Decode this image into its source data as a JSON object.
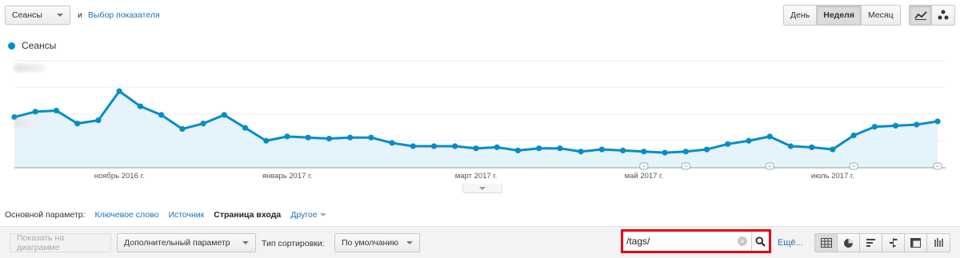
{
  "top": {
    "metric_select": "Сеансы",
    "and_text": "и",
    "choose_metric_link": "Выбор показателя"
  },
  "period_buttons": [
    "День",
    "Неделя",
    "Месяц"
  ],
  "period_active": "Неделя",
  "view_buttons": [
    "line-chart-icon",
    "motion-chart-icon"
  ],
  "legend": {
    "series_name": "Сеансы",
    "color": "#058dc7"
  },
  "chart_data": {
    "type": "area",
    "title": "",
    "xlabel": "",
    "ylabel": "",
    "x_tick_labels": [
      "ноябрь 2016 г.",
      "январь 2017 г.",
      "март 2017 г.",
      "май 2017 г.",
      "июль 2017 г."
    ],
    "series": [
      {
        "name": "Сеансы",
        "color": "#058dc7",
        "values": [
          0.47,
          0.52,
          0.53,
          0.41,
          0.44,
          0.71,
          0.57,
          0.49,
          0.36,
          0.41,
          0.49,
          0.37,
          0.25,
          0.29,
          0.28,
          0.27,
          0.28,
          0.28,
          0.23,
          0.2,
          0.2,
          0.2,
          0.18,
          0.19,
          0.16,
          0.18,
          0.18,
          0.15,
          0.17,
          0.16,
          0.15,
          0.14,
          0.15,
          0.17,
          0.22,
          0.25,
          0.29,
          0.2,
          0.19,
          0.17,
          0.3,
          0.38,
          0.39,
          0.4,
          0.43
        ]
      }
    ],
    "annotation_markers": 5,
    "grid": true,
    "legend": "top-left"
  },
  "dimensions": {
    "label": "Основной параметр:",
    "items": [
      "Ключевое слово",
      "Источник",
      "Страница входа"
    ],
    "active": "Страница входа",
    "other": "Другое"
  },
  "toolbar": {
    "plot_rows": "Показать на диаграмме",
    "secondary_dim": "Дополнительный параметр",
    "sort_label": "Тип сортировки:",
    "sort_value": "По умолчанию",
    "search_value": "/tags/",
    "more": "Ещё...",
    "view_icons": [
      "table-icon",
      "pie-icon",
      "bar-icon",
      "comparison-icon",
      "pivot-icon",
      "term-cloud-icon"
    ]
  }
}
